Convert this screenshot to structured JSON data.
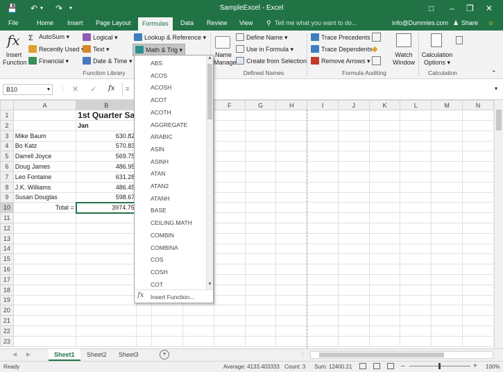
{
  "window": {
    "title": "SampleExcel - Excel",
    "user": "info@Dummies.com",
    "share_label": "Share",
    "tell_me": "Tell me what you want to do..."
  },
  "tabs": [
    "File",
    "Home",
    "Insert",
    "Page Layout",
    "Formulas",
    "Data",
    "Review",
    "View"
  ],
  "active_tab": "Formulas",
  "ribbon": {
    "insert_function": [
      "Insert",
      "Function"
    ],
    "library": {
      "autosum": "AutoSum",
      "recently_used": "Recently Used",
      "financial": "Financial",
      "logical": "Logical",
      "text": "Text",
      "date_time": "Date & Time",
      "lookup": "Lookup & Reference",
      "math_trig": "Math & Trig",
      "group_label": "Function Library"
    },
    "names": {
      "name_manager": [
        "Name",
        "Manager"
      ],
      "define_name": "Define Name",
      "use_in_formula": "Use in Formula",
      "create_from_selection": "Create from Selection",
      "group_label": "Defined Names"
    },
    "auditing": {
      "trace_precedents": "Trace Precedents",
      "trace_dependents": "Trace Dependents",
      "remove_arrows": "Remove Arrows",
      "watch_window": [
        "Watch",
        "Window"
      ],
      "group_label": "Formula Auditing"
    },
    "calculation": {
      "options": [
        "Calculation",
        "Options"
      ],
      "group_label": "Calculation"
    }
  },
  "formula_bar": {
    "name_box": "B10",
    "fx": "fx",
    "content": "="
  },
  "columns": [
    "A",
    "B",
    "C",
    "D",
    "E",
    "F",
    "G",
    "H",
    "I",
    "J",
    "K",
    "L",
    "M",
    "N"
  ],
  "rows": [
    [
      "",
      "1st Quarter Sa",
      ""
    ],
    [
      "",
      "Jan",
      "Feb"
    ],
    [
      "Mike Baum",
      "630.82",
      "5"
    ],
    [
      "Bo Katz",
      "570.83",
      "4"
    ],
    [
      "Darrell Joyce",
      "569.75",
      "6"
    ],
    [
      "Doug James",
      "486.95",
      "6"
    ],
    [
      "Leo Fontaine",
      "631.28",
      "5"
    ],
    [
      "J.K. Williams",
      "486.45",
      "6"
    ],
    [
      "Susan Douglas",
      "598.67",
      "6"
    ],
    [
      "Total =",
      "3974.75",
      "42"
    ]
  ],
  "dropdown": {
    "items": [
      "ABS",
      "ACOS",
      "ACOSH",
      "ACOT",
      "ACOTH",
      "AGGREGATE",
      "ARABIC",
      "ASIN",
      "ASINH",
      "ATAN",
      "ATAN2",
      "ATANH",
      "BASE",
      "CEILING.MATH",
      "COMBIN",
      "COMBINA",
      "COS",
      "COSH",
      "COT"
    ],
    "insert_function": "Insert Function..."
  },
  "sheets": [
    "Sheet1",
    "Sheet2",
    "Sheet3"
  ],
  "active_sheet": "Sheet1",
  "status": {
    "ready": "Ready",
    "average": "Average: 4133.403333",
    "count": "Count: 3",
    "sum": "Sum: 12400.21",
    "zoom": "100%"
  },
  "colors": {
    "brand": "#217346"
  }
}
